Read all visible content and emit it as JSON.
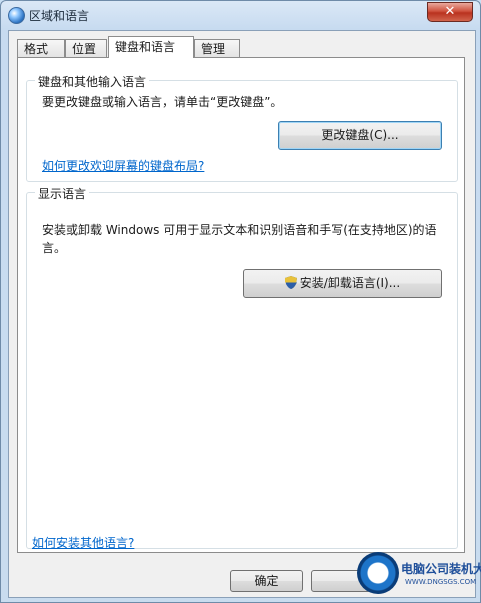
{
  "window": {
    "title": "区域和语言",
    "close_label": "✕"
  },
  "tabs": [
    {
      "label": "格式",
      "active": false
    },
    {
      "label": "位置",
      "active": false
    },
    {
      "label": "键盘和语言",
      "active": true
    },
    {
      "label": "管理",
      "active": false
    }
  ],
  "keyboard_group": {
    "legend": "键盘和其他输入语言",
    "description": "要更改键盘或输入语言，请单击“更改键盘”。",
    "change_button": "更改键盘(C)...",
    "link": "如何更改欢迎屏幕的键盘布局?"
  },
  "display_group": {
    "legend": "显示语言",
    "description": "安装或卸载 Windows 可用于显示文本和识别语音和手写(在支持地区)的语言。",
    "install_button": "安装/卸载语言(I)...",
    "install_button_icon": "uac-shield-icon"
  },
  "footer": {
    "link": "如何安装其他语言?",
    "ok_button": "确定"
  },
  "watermark": {
    "line1": "电脑公司装机大师",
    "line2": "WWW.DNGSGS.COM"
  },
  "colors": {
    "link": "#0066cc",
    "close_button": "#c94a35",
    "default_button_border": "#3c7fb1"
  }
}
